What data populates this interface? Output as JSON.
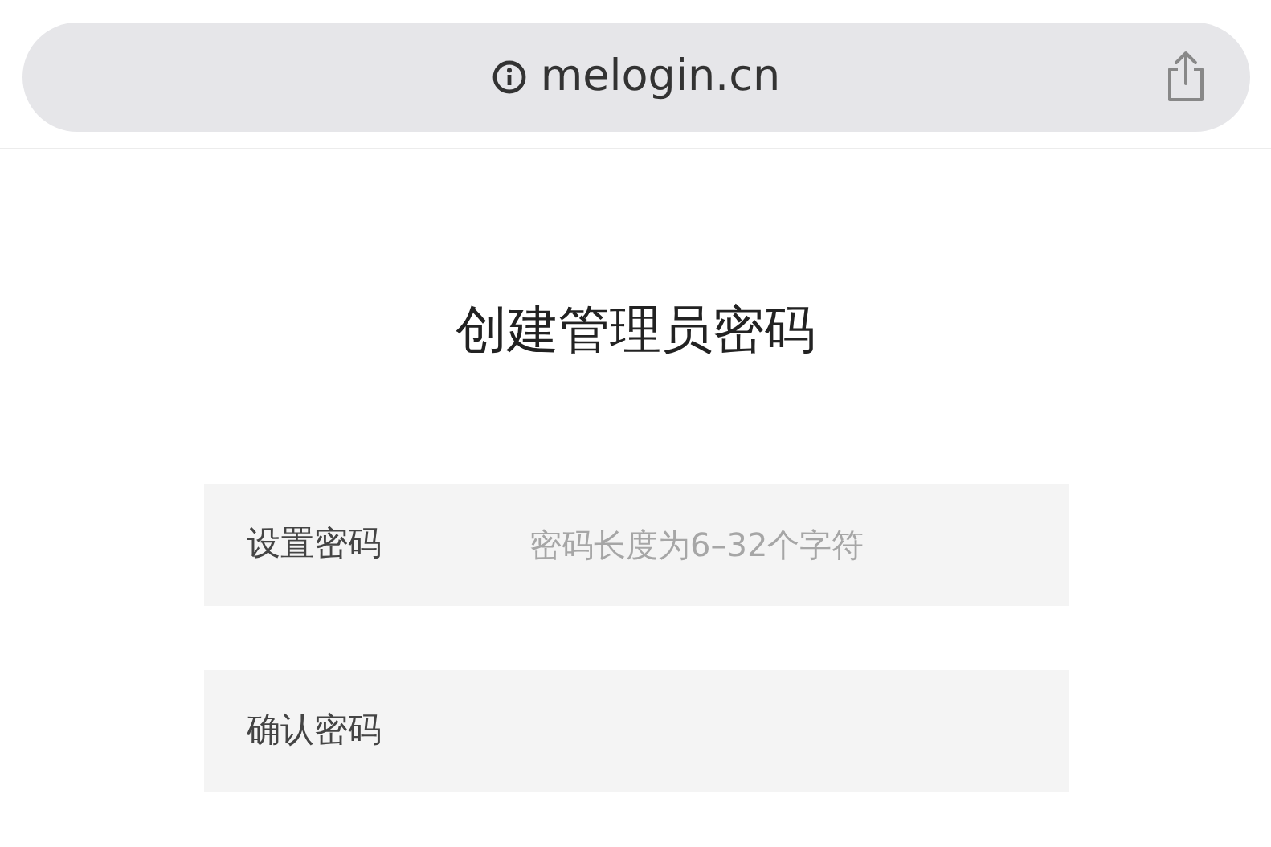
{
  "address_bar": {
    "url": "melogin.cn"
  },
  "title": "创建管理员密码",
  "fields": [
    {
      "label": "设置密码",
      "placeholder": "密码长度为6–32个字符"
    },
    {
      "label": "确认密码"
    }
  ]
}
